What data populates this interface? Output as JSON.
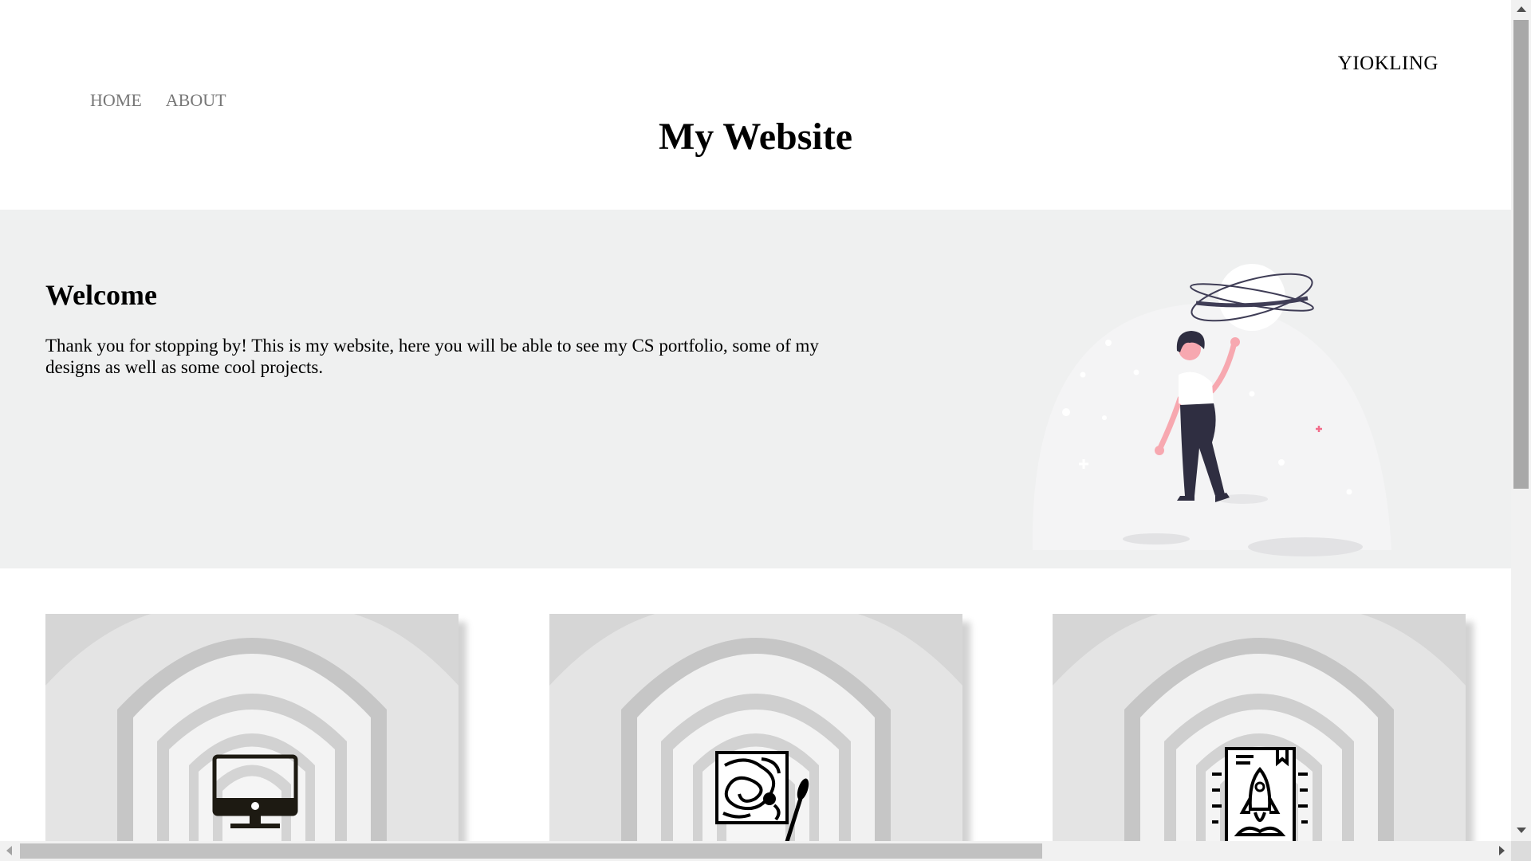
{
  "header": {
    "brand": "YIOKLING",
    "nav": [
      {
        "label": "HOME"
      },
      {
        "label": "ABOUT"
      }
    ],
    "title": "My Website"
  },
  "hero": {
    "heading": "Welcome",
    "text": "Thank you for stopping by! This is my website, here you will be able to see my CS portfolio, some of my designs as well as some cool projects.",
    "illustration": "woman-touching-planet-illustration"
  },
  "cards": [
    {
      "icon": "computer-monitor-icon"
    },
    {
      "icon": "paint-palette-brush-icon"
    },
    {
      "icon": "rocket-book-icon"
    }
  ],
  "colors": {
    "hero_bg": "#eff0f0",
    "nav_text": "#777777",
    "accent": "#f26d8b"
  }
}
